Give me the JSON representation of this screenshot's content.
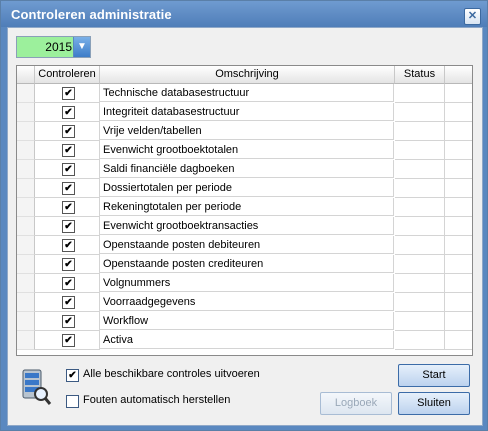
{
  "window": {
    "title": "Controleren administratie",
    "close_glyph": "✕"
  },
  "year_select": {
    "value": "2015",
    "arrow_glyph": "▼"
  },
  "grid": {
    "columns": {
      "check": "Controleren",
      "description": "Omschrijving",
      "status": "Status"
    },
    "rows": [
      {
        "checked": true,
        "description": "Technische databasestructuur",
        "status": ""
      },
      {
        "checked": true,
        "description": "Integriteit databasestructuur",
        "status": ""
      },
      {
        "checked": true,
        "description": "Vrije velden/tabellen",
        "status": ""
      },
      {
        "checked": true,
        "description": "Evenwicht grootboektotalen",
        "status": ""
      },
      {
        "checked": true,
        "description": "Saldi financiële dagboeken",
        "status": ""
      },
      {
        "checked": true,
        "description": "Dossiertotalen per periode",
        "status": ""
      },
      {
        "checked": true,
        "description": "Rekeningtotalen per periode",
        "status": ""
      },
      {
        "checked": true,
        "description": "Evenwicht grootboektransacties",
        "status": ""
      },
      {
        "checked": true,
        "description": "Openstaande posten debiteuren",
        "status": ""
      },
      {
        "checked": true,
        "description": "Openstaande posten crediteuren",
        "status": ""
      },
      {
        "checked": true,
        "description": "Volgnummers",
        "status": ""
      },
      {
        "checked": true,
        "description": "Voorraadgegevens",
        "status": ""
      },
      {
        "checked": true,
        "description": "Workflow",
        "status": ""
      },
      {
        "checked": true,
        "description": "Activa",
        "status": ""
      }
    ]
  },
  "options": {
    "run_all": {
      "label": "Alle beschikbare controles uitvoeren",
      "checked": true
    },
    "auto_fix": {
      "label": "Fouten automatisch herstellen",
      "checked": false
    }
  },
  "buttons": {
    "start": "Start",
    "log": "Logboek",
    "close": "Sluiten"
  },
  "icons": {
    "check_glyph": "✔",
    "db_icon": "database-search-icon"
  }
}
